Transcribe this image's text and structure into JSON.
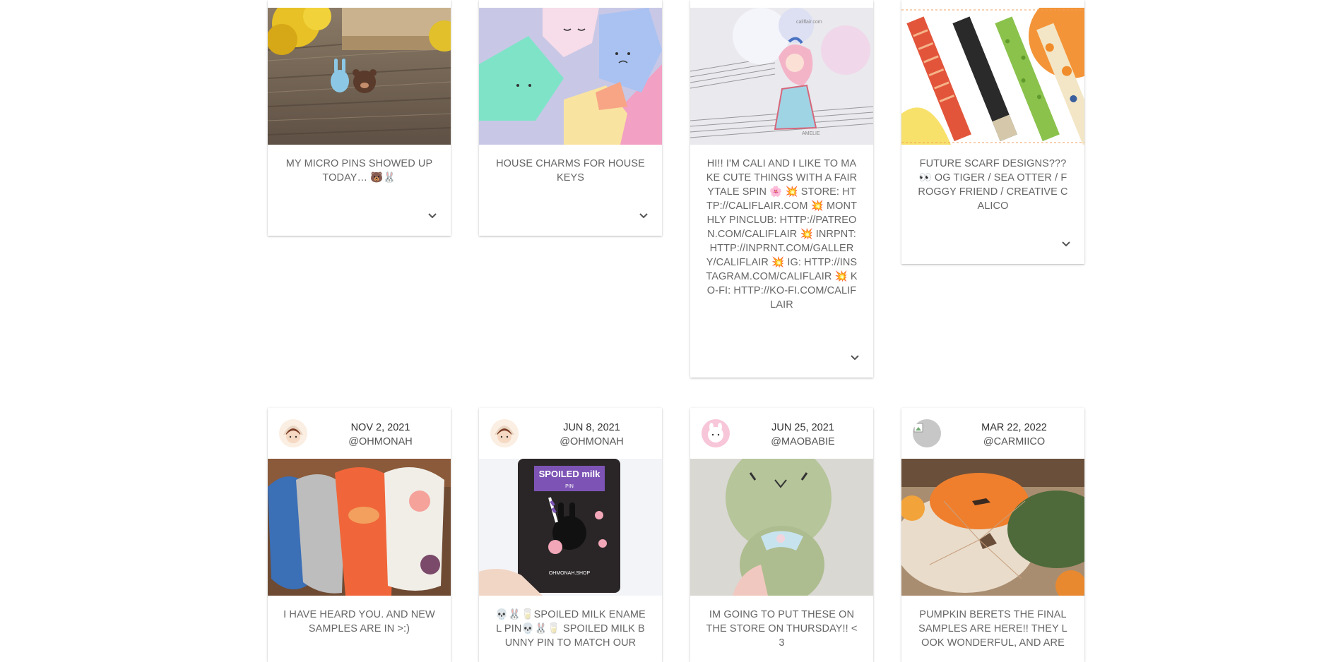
{
  "feed": {
    "row1": [
      {
        "caption": "MY MICRO PINS SHOWED UP TODAY… 🐻🐰"
      },
      {
        "caption": "HOUSE CHARMS FOR HOUSE KEYS"
      },
      {
        "caption": "HI!! I'M CALI AND I LIKE TO MAKE CUTE THINGS WITH A FAIRYTALE SPIN 🌸 💥 STORE: HTTP://CALIFLAIR.COM 💥 MONTHLY PINCLUB: HTTP://PATREON.COM/CALIFLAIR 💥 INRPNT: HTTP://INPRNT.COM/GALLERY/CALIFLAIR 💥 IG: HTTP://INSTAGRAM.COM/CALIFLAIR 💥 KO-FI: HTTP://KO-FI.COM/CALIFLAIR",
        "image_text_top": "califlair.com",
        "image_text_bottom": "AMELIE"
      },
      {
        "caption": "FUTURE SCARF DESIGNS??? 👀 OG TIGER / SEA OTTER / FROGGY FRIEND / CREATIVE CALICO"
      }
    ],
    "row2": [
      {
        "date": "NOV 2, 2021",
        "handle": "@OHMONAH",
        "caption": "I HAVE HEARD YOU. AND NEW SAMPLES ARE IN >:)"
      },
      {
        "date": "JUN 8, 2021",
        "handle": "@OHMONAH",
        "caption": "💀🐰🥛SPOILED MILK ENAMEL PIN💀🐰🥛 SPOILED MILK BUNNY PIN TO MATCH OUR",
        "image_title": "SPOILED milk",
        "image_sub": "PIN",
        "image_shop": "OHMONAH.SHOP"
      },
      {
        "date": "JUN 25, 2021",
        "handle": "@MAOBABIE",
        "caption": "IM GOING TO PUT THESE ON THE STORE ON THURSDAY!! <3"
      },
      {
        "date": "MAR 22, 2022",
        "handle": "@CARMIICO",
        "caption": "PUMPKIN BERETS THE FINAL SAMPLES ARE HERE!! THEY LOOK WONDERFUL, AND ARE"
      }
    ]
  },
  "icons": {
    "expand": "chevron-down-icon"
  }
}
